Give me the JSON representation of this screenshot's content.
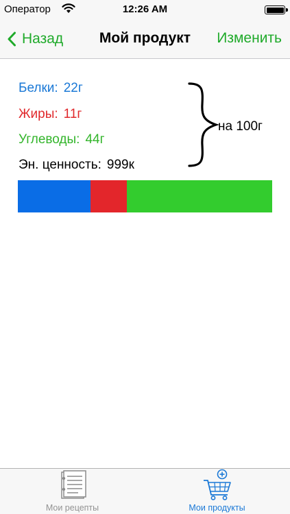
{
  "status_bar": {
    "carrier": "Оператор",
    "time": "12:26 AM"
  },
  "nav": {
    "back_label": "Назад",
    "title": "Мой продукт",
    "edit_label": "Изменить"
  },
  "nutrition": {
    "protein": {
      "label": "Белки:",
      "value": "22г",
      "color": "#1a78d6"
    },
    "fat": {
      "label": "Жиры:",
      "value": "11г",
      "color": "#e0282b"
    },
    "carbs": {
      "label": "Углеводы:",
      "value": "44г",
      "color": "#33b52b"
    },
    "energy": {
      "label": "Эн. ценность:",
      "value": "999к"
    },
    "per_label": "на 100г"
  },
  "composition_bar": {
    "segments": [
      {
        "name": "protein",
        "fraction": 0.286,
        "color": "#0a6de6"
      },
      {
        "name": "fat",
        "fraction": 0.143,
        "color": "#e3262b"
      },
      {
        "name": "carbs",
        "fraction": 0.571,
        "color": "#33cc2e"
      }
    ]
  },
  "tabbar": {
    "tabs": [
      {
        "label": "Мои рецепты",
        "icon": "recipes-notepad-icon",
        "selected": false
      },
      {
        "label": "Мои продукты",
        "icon": "cart-add-icon",
        "selected": true
      }
    ]
  },
  "colors": {
    "accent": "#1faa2a",
    "selected_tab": "#1a78d6",
    "unselected_tab": "#929292"
  }
}
